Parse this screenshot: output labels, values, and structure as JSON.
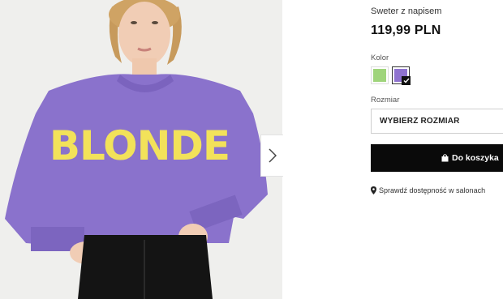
{
  "product": {
    "name": "Sweter z napisem",
    "price": "119,99 PLN",
    "print_text": "BLONDE"
  },
  "colors": {
    "label": "Kolor",
    "options": [
      {
        "name": "green",
        "hex": "#9fd47b",
        "selected": false
      },
      {
        "name": "purple",
        "hex": "#8f73cf",
        "selected": true
      }
    ]
  },
  "size": {
    "label": "Rozmiar",
    "select_placeholder": "WYBIERZ ROZMIAR"
  },
  "cart": {
    "button_label": "Do koszyka",
    "icon": "shopping-bag-icon"
  },
  "store": {
    "link_label": "Sprawdź dostępność w salonach",
    "icon": "location-pin-icon"
  },
  "gallery": {
    "next_icon": "chevron-right-icon"
  },
  "theme": {
    "sweater_color": "#8a72cc",
    "text_print_color": "#f2e25a",
    "button_bg": "#0a0a0a"
  }
}
